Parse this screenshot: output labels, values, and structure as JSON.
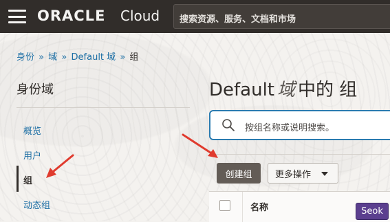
{
  "header": {
    "logo_oracle": "ORACLE",
    "logo_cloud": "Cloud",
    "search_placeholder": "搜索资源、服务、文档和市场"
  },
  "breadcrumb": {
    "items": [
      "身份",
      "域",
      "Default 域",
      "组"
    ],
    "separator": "»"
  },
  "sidebar": {
    "title": "身份域",
    "items": [
      {
        "label": "概览"
      },
      {
        "label": "用户"
      },
      {
        "label": "组",
        "active": true
      },
      {
        "label": "动态组"
      }
    ]
  },
  "main": {
    "title_prefix": "Default",
    "title_italic": "域",
    "title_suffix": "中的 组",
    "search_placeholder": "按组名称或说明搜索。",
    "create_button": "创建组",
    "more_actions_button": "更多操作",
    "table_headers": [
      "名称"
    ]
  },
  "badge": {
    "label": "Seok"
  },
  "colors": {
    "topbar": "#312d2a",
    "link": "#1d6fa5",
    "arrow": "#e03b2e",
    "badge": "#5b3f8f"
  }
}
